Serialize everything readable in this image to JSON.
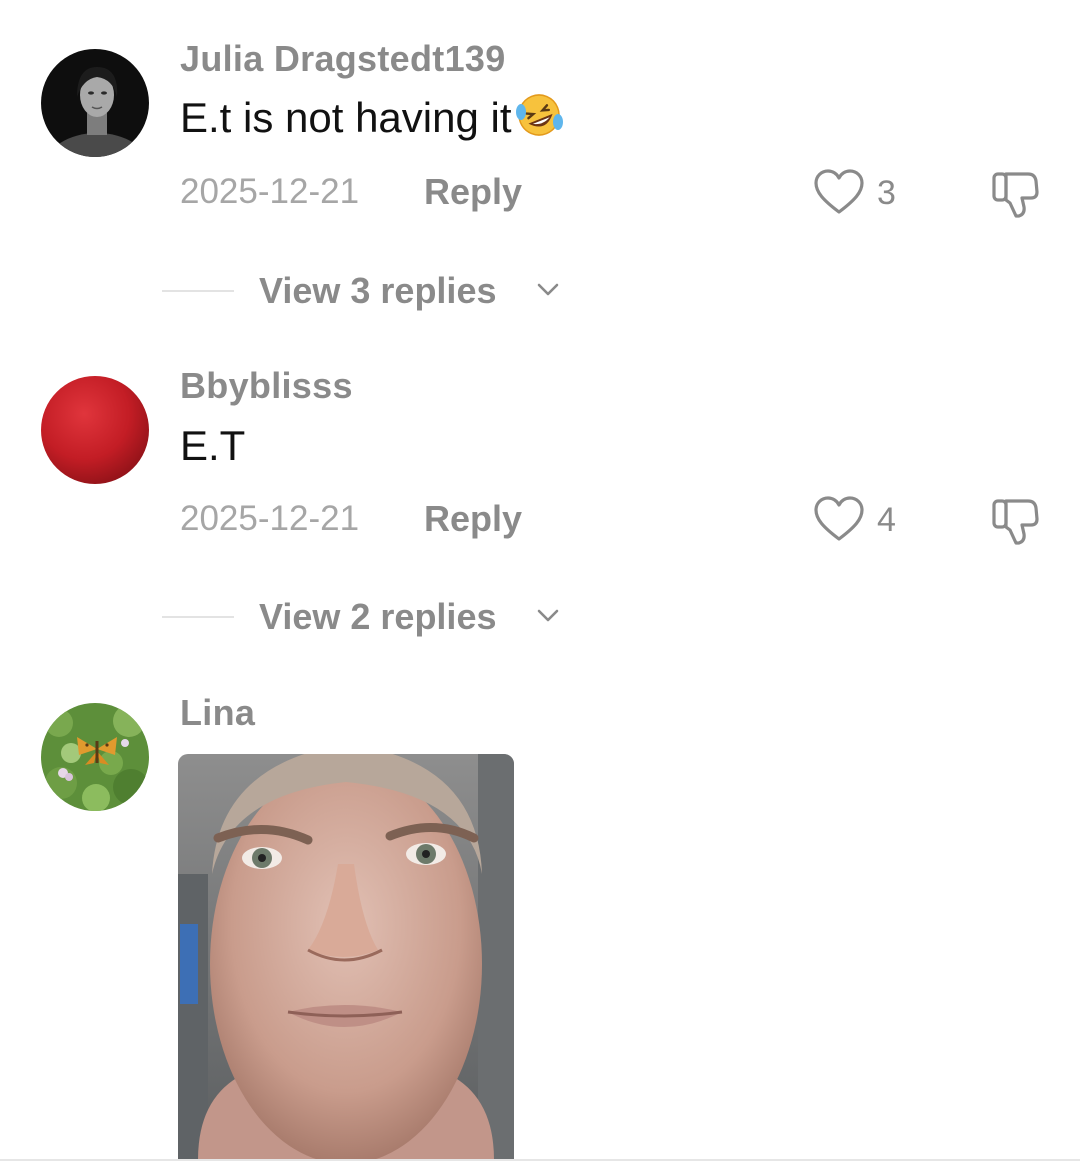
{
  "comments": [
    {
      "username": "Julia Dragstedt139",
      "text": "E.t is not having it",
      "emoji": "rolling-on-floor-laughing",
      "date": "2025-12-21",
      "reply_label": "Reply",
      "likes": "3",
      "view_replies": "View 3 replies",
      "avatar": "woman-portrait-bw"
    },
    {
      "username": "Bbyblisss",
      "text": "E.T",
      "date": "2025-12-21",
      "reply_label": "Reply",
      "likes": "4",
      "view_replies": "View 2 replies",
      "avatar": "red-circle"
    },
    {
      "username": "Lina",
      "avatar": "butterfly-on-leaves",
      "attachment": "photo-of-man-face"
    }
  ],
  "icons": {
    "like": "heart-icon",
    "dislike": "thumbs-down-icon",
    "expand": "chevron-down-icon"
  },
  "colors": {
    "username": "#8a8a8a",
    "text": "#111111",
    "date": "#a6a6a6",
    "divider": "#e3e3e3"
  }
}
